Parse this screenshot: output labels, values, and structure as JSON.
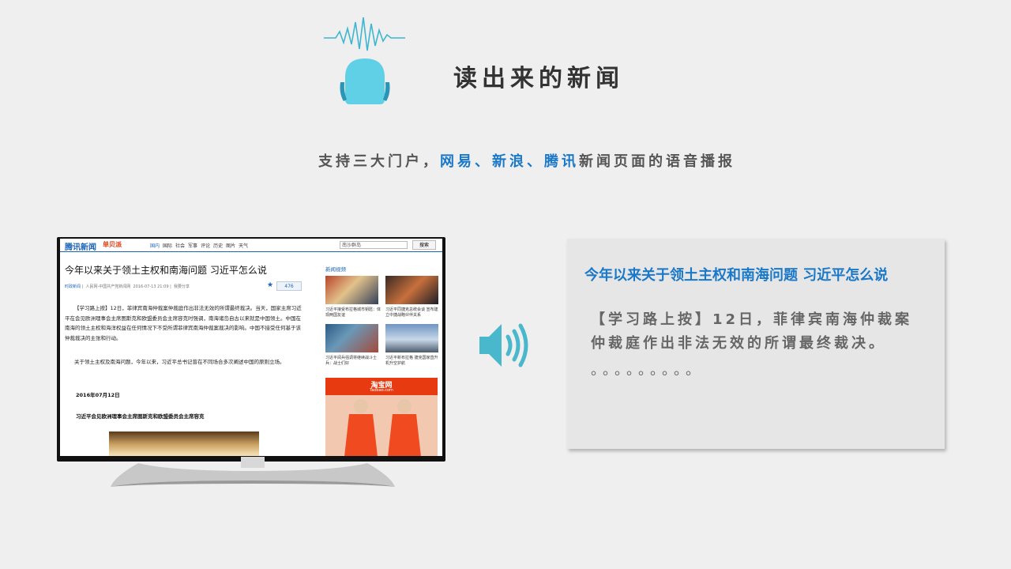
{
  "header": {
    "title": "读出来的新闻",
    "subtitle_prefix": "支持三大门户，",
    "portal_1": "网易",
    "sep_1": "、",
    "portal_2": "新浪",
    "sep_2": "、",
    "portal_3": "腾讯",
    "subtitle_suffix": "新闻页面的语音播报"
  },
  "news_page": {
    "logo": "腾讯新闻",
    "logo_sub": "单贝派",
    "nav": [
      "国内",
      "国际",
      "社会",
      "军事",
      "评论",
      "历史",
      "图片",
      "天气"
    ],
    "search_value": "南沙群岛",
    "search_button": "搜索",
    "headline": "今年以来关于领土主权和南海问题 习近平怎么说",
    "meta_channel": "时政新闻",
    "meta_source": "人民网-中国共产党新闻网",
    "meta_time": "2016-07-13 21:09",
    "meta_share": "我要分享",
    "comment_count": "476",
    "paragraph_1": "【学习路上按】12日，菲律宾南海仲裁案仲裁庭作出非法无效的所谓最终裁决。当天，国家主席习近平在会见欧洲理事会主席图斯克和欧盟委员会主席容克时强调，南海诸岛自古以来就是中国领土。中国在南海的领土主权和海洋权益在任何情况下不受所谓菲律宾南海仲裁案裁决的影响。中国不接受任何基于该仲裁裁决的主张和行动。",
    "paragraph_2": "关于领土主权及南海问题，今年以来，习近平总书记曾在不同场合多次阐述中国的原则立场。",
    "date_line": "2016年07月12日",
    "caption_line": "习近平会见欧洲理事会主席图斯克和欧盟委员会主席容克",
    "side_title": "新闻视频",
    "videos": [
      {
        "caption": "习近平接受布拉格城市钥匙：体现两国友谊"
      },
      {
        "caption": "习近平同捷克总统会谈 宣布建立中捷战略伙伴关系"
      },
      {
        "caption": "习近平阅兵强调将继续战斗士兵：战士们好"
      },
      {
        "caption": "习近平新布拉格 捷克国家直升机升空护航"
      }
    ],
    "ad_logo": "淘宝网",
    "ad_sub": "Taobao.com"
  },
  "panel": {
    "title": "今年以来关于领土主权和南海问题 习近平怎么说",
    "body": "【学习路上按】12日，菲律宾南海仲裁案仲裁庭作出非法无效的所谓最终裁决。",
    "dots": "。。。。。。。。。"
  },
  "colors": {
    "accent": "#1a78c8",
    "mic": "#5fd0e6",
    "speaker": "#4ab8cc"
  }
}
